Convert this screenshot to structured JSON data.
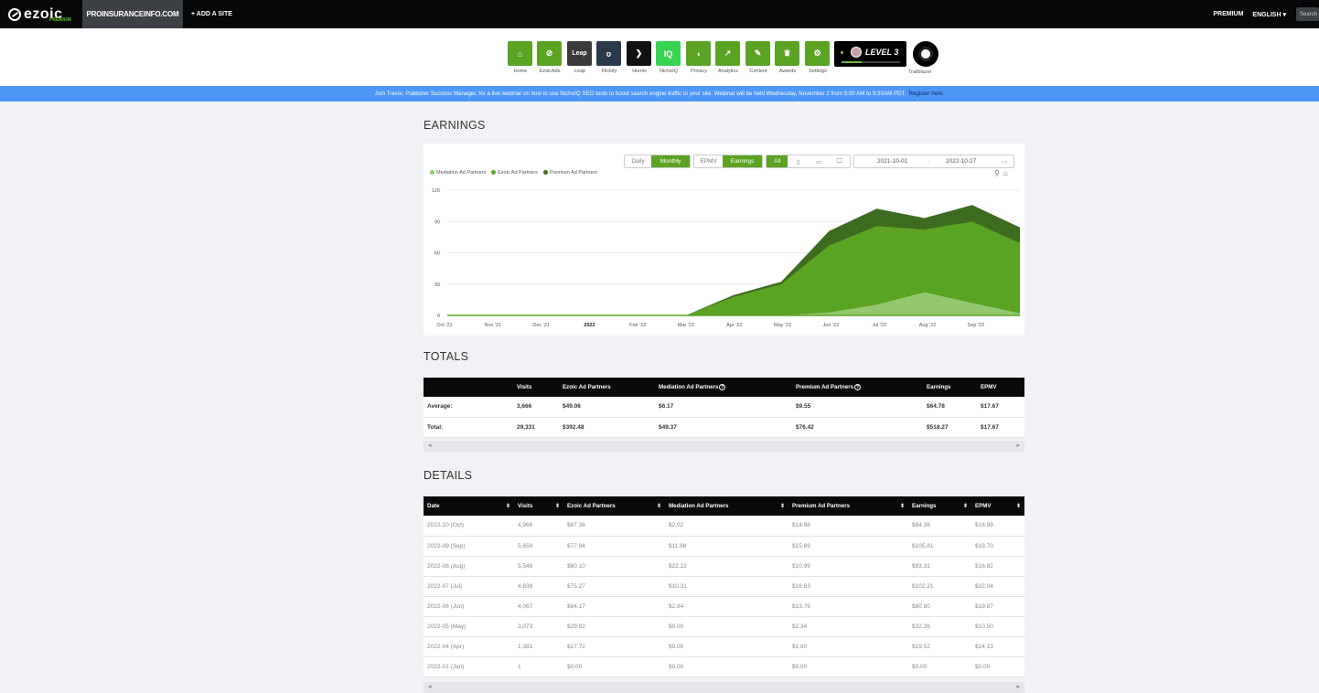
{
  "topbar": {
    "logo": "ezoic",
    "logo_sub": "PREMIUM",
    "site": "PROINSURANCEINFO.COM",
    "add_site": "+ ADD A SITE",
    "premium": "PREMIUM",
    "language": "ENGLISH ▾",
    "search_placeholder": "Search"
  },
  "nav": [
    {
      "label": "Home",
      "color": "#5ba323",
      "icon": "home-icon",
      "glyph": "⌂"
    },
    {
      "label": "EzoicAds",
      "color": "#5ba323",
      "icon": "ezoic-ads-icon",
      "glyph": "⊘"
    },
    {
      "label": "Leap",
      "color": "#3a3a3a",
      "icon": "leap-icon",
      "glyph": "Leap"
    },
    {
      "label": "Flickify",
      "color": "#2b3a4a",
      "icon": "flickify-icon",
      "glyph": "ʋ"
    },
    {
      "label": "Humix",
      "color": "#111111",
      "icon": "humix-icon",
      "glyph": "❯"
    },
    {
      "label": "NicheIQ",
      "color": "#39d353",
      "icon": "nicheiq-icon",
      "glyph": "IQ"
    },
    {
      "label": "Privacy",
      "color": "#5ba323",
      "icon": "shield-icon",
      "glyph": "◖"
    },
    {
      "label": "Analytics",
      "color": "#5ba323",
      "icon": "analytics-icon",
      "glyph": "↗"
    },
    {
      "label": "Content",
      "color": "#5ba323",
      "icon": "content-icon",
      "glyph": "✎"
    },
    {
      "label": "Awards",
      "color": "#5ba323",
      "icon": "trophy-icon",
      "glyph": "♛"
    },
    {
      "label": "Settings",
      "color": "#5ba323",
      "icon": "gear-icon",
      "glyph": "⚙"
    }
  ],
  "level": {
    "text": "LEVEL 3",
    "progress": 0.34
  },
  "trailblazer": {
    "label": "Trailblazer"
  },
  "banner": {
    "text": "Join Trevor, Publisher Success Manager, for a live webinar on how to use NicheIQ SEO tools to boost search engine traffic to your site. Webinar will be held Wednesday, November 2 from 9:00 AM to 9:30AM PDT.",
    "link": "Register here."
  },
  "earnings": {
    "title": "EARNINGS",
    "period_buttons": [
      "Daily",
      "Monthly"
    ],
    "metric_buttons": [
      "EPMV",
      "Earnings"
    ],
    "device_buttons": [
      "All",
      "▯",
      "▭",
      "🖵"
    ],
    "date_from": "2021-10-01",
    "date_sep": "→",
    "date_to": "2022-10-27"
  },
  "chart_data": {
    "type": "area",
    "stacked": true,
    "categories": [
      "Oct '21",
      "Nov '21",
      "Dec '21",
      "2022",
      "Feb '22",
      "Mar '22",
      "Apr '22",
      "May '22",
      "Jun '22",
      "Jul '22",
      "Aug '22",
      "Sep '22"
    ],
    "x_points": [
      "2021-10",
      "2021-11",
      "2021-12",
      "2022-01",
      "2022-02",
      "2022-03",
      "2022-04",
      "2022-05",
      "2022-06",
      "2022-07",
      "2022-08",
      "2022-09",
      "2022-10"
    ],
    "series": [
      {
        "name": "Mediation Ad Partners",
        "color": "#93c86f",
        "values": [
          0,
          0,
          0,
          0,
          0,
          0,
          0,
          0,
          2.84,
          10.31,
          22.22,
          11.98,
          2.02
        ]
      },
      {
        "name": "Ezoic Ad Partners",
        "color": "#5ba323",
        "values": [
          0,
          0,
          0,
          0,
          0,
          0,
          17.72,
          29.92,
          64.17,
          75.27,
          60.1,
          77.94,
          67.36
        ]
      },
      {
        "name": "Premium Ad Partners",
        "color": "#3d6b1f",
        "values": [
          0,
          0,
          0,
          0,
          0,
          0,
          1.8,
          2.34,
          13.79,
          16.63,
          10.99,
          15.89,
          14.98
        ]
      }
    ],
    "yticks": [
      0,
      30,
      60,
      90,
      120
    ],
    "ylim": [
      0,
      120
    ],
    "grid": true,
    "legend": "top-left"
  },
  "totals": {
    "title": "TOTALS",
    "headers": [
      "",
      "Visits",
      "Ezoic Ad Partners",
      "Mediation Ad Partners",
      "Premium Ad Partners",
      "Earnings",
      "EPMV"
    ],
    "rows": [
      [
        "Average:",
        "3,666",
        "$49.06",
        "$6.17",
        "$9.55",
        "$64.78",
        "$17.67"
      ],
      [
        "Total:",
        "29,331",
        "$392.48",
        "$49.37",
        "$76.42",
        "$518.27",
        "$17.67"
      ]
    ]
  },
  "details": {
    "title": "DETAILS",
    "headers": [
      "Date",
      "Visits",
      "Ezoic Ad Partners",
      "Mediation Ad Partners",
      "Premium Ad Partners",
      "Earnings",
      "EPMV"
    ],
    "rows": [
      [
        "2022-10 (Oct)",
        "4,966",
        "$67.36",
        "$2.02",
        "$14.98",
        "$84.36",
        "$16.99"
      ],
      [
        "2022-09 (Sep)",
        "5,659",
        "$77.94",
        "$11.98",
        "$15.89",
        "$105.81",
        "$18.70"
      ],
      [
        "2022-08 (Aug)",
        "5,546",
        "$60.10",
        "$22.22",
        "$10.99",
        "$93.31",
        "$16.82"
      ],
      [
        "2022-07 (Jul)",
        "4,638",
        "$75.27",
        "$10.31",
        "$16.63",
        "$102.21",
        "$22.04"
      ],
      [
        "2022-06 (Jun)",
        "4,067",
        "$64.17",
        "$2.84",
        "$13.79",
        "$80.80",
        "$19.87"
      ],
      [
        "2022-05 (May)",
        "3,073",
        "$29.92",
        "$0.00",
        "$2.34",
        "$32.26",
        "$10.50"
      ],
      [
        "2022-04 (Apr)",
        "1,381",
        "$17.72",
        "$0.00",
        "$1.80",
        "$19.52",
        "$14.13"
      ],
      [
        "2022-01 (Jan)",
        "1",
        "$0.00",
        "$0.00",
        "$0.00",
        "$0.00",
        "$0.00"
      ]
    ]
  }
}
